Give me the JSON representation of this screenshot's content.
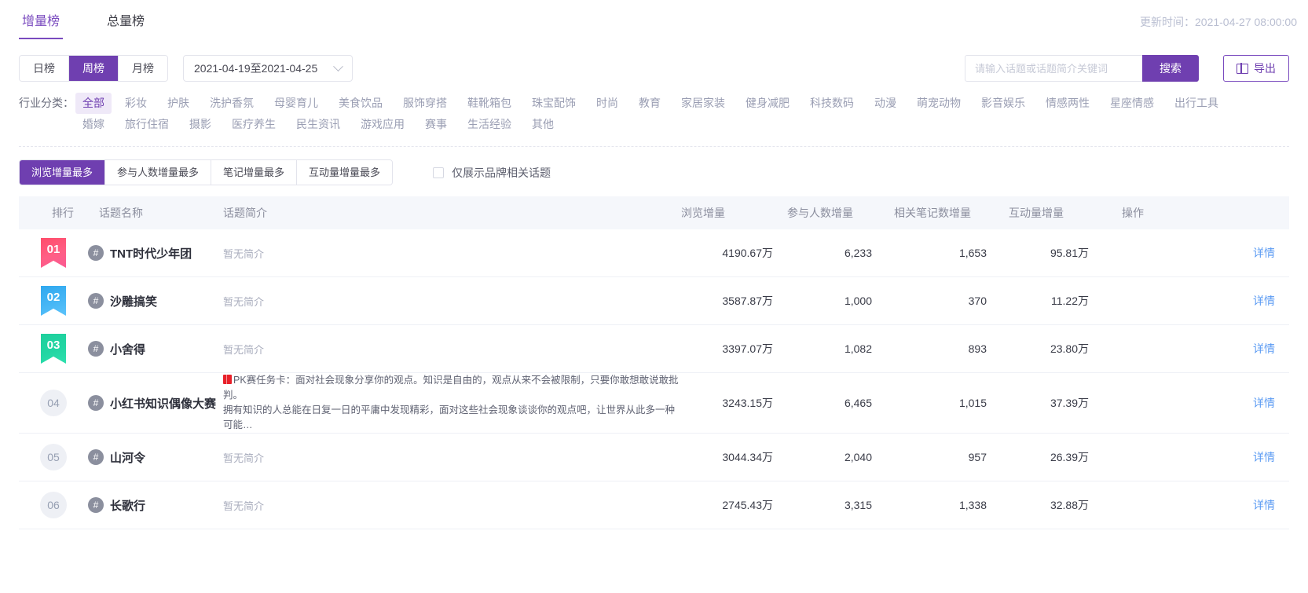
{
  "header": {
    "tabs": [
      {
        "label": "增量榜",
        "active": true
      },
      {
        "label": "总量榜",
        "active": false
      }
    ],
    "update_time": "更新时间：2021-04-27 08:00:00"
  },
  "filters": {
    "period": [
      {
        "label": "日榜",
        "active": false
      },
      {
        "label": "周榜",
        "active": true
      },
      {
        "label": "月榜",
        "active": false
      }
    ],
    "date_range": "2021-04-19至2021-04-25",
    "search_placeholder": "请输入话题或话题简介关键词",
    "search_value": "",
    "search_button": "搜索",
    "export_button": "导出"
  },
  "categories": {
    "label": "行业分类：",
    "items": [
      {
        "label": "全部",
        "active": true
      },
      {
        "label": "彩妆",
        "active": false
      },
      {
        "label": "护肤",
        "active": false
      },
      {
        "label": "洗护香氛",
        "active": false
      },
      {
        "label": "母婴育儿",
        "active": false
      },
      {
        "label": "美食饮品",
        "active": false
      },
      {
        "label": "服饰穿搭",
        "active": false
      },
      {
        "label": "鞋靴箱包",
        "active": false
      },
      {
        "label": "珠宝配饰",
        "active": false
      },
      {
        "label": "时尚",
        "active": false
      },
      {
        "label": "教育",
        "active": false
      },
      {
        "label": "家居家装",
        "active": false
      },
      {
        "label": "健身减肥",
        "active": false
      },
      {
        "label": "科技数码",
        "active": false
      },
      {
        "label": "动漫",
        "active": false
      },
      {
        "label": "萌宠动物",
        "active": false
      },
      {
        "label": "影音娱乐",
        "active": false
      },
      {
        "label": "情感两性",
        "active": false
      },
      {
        "label": "星座情感",
        "active": false
      },
      {
        "label": "出行工具",
        "active": false
      },
      {
        "label": "婚嫁",
        "active": false
      },
      {
        "label": "旅行住宿",
        "active": false
      },
      {
        "label": "摄影",
        "active": false
      },
      {
        "label": "医疗养生",
        "active": false
      },
      {
        "label": "民生资讯",
        "active": false
      },
      {
        "label": "游戏应用",
        "active": false
      },
      {
        "label": "赛事",
        "active": false
      },
      {
        "label": "生活经验",
        "active": false
      },
      {
        "label": "其他",
        "active": false
      }
    ]
  },
  "sort": {
    "options": [
      {
        "label": "浏览增量最多",
        "active": true
      },
      {
        "label": "参与人数增量最多",
        "active": false
      },
      {
        "label": "笔记增量最多",
        "active": false
      },
      {
        "label": "互动量增量最多",
        "active": false
      }
    ],
    "brand_only_label": "仅展示品牌相关话题",
    "brand_only_checked": false
  },
  "table": {
    "columns": [
      "排行",
      "话题名称",
      "话题简介",
      "浏览增量",
      "参与人数增量",
      "相关笔记数增量",
      "互动量增量",
      "操作"
    ],
    "action_label": "详情",
    "rows": [
      {
        "rank": "01",
        "rank_style": "ribbon-1",
        "name": "TNT时代少年团",
        "desc": "暂无简介",
        "desc_rich": false,
        "views": "4190.67万",
        "users": "6,233",
        "notes": "1,653",
        "interactions": "95.81万"
      },
      {
        "rank": "02",
        "rank_style": "ribbon-2",
        "name": "沙雕搞笑",
        "desc": "暂无简介",
        "desc_rich": false,
        "views": "3587.87万",
        "users": "1,000",
        "notes": "370",
        "interactions": "11.22万"
      },
      {
        "rank": "03",
        "rank_style": "ribbon-3",
        "name": "小舍得",
        "desc": "暂无简介",
        "desc_rich": false,
        "views": "3397.07万",
        "users": "1,082",
        "notes": "893",
        "interactions": "23.80万"
      },
      {
        "rank": "04",
        "rank_style": "circle",
        "name": "小红书知识偶像大赛",
        "desc_line1": "PK赛任务卡：面对社会现象分享你的观点。知识是自由的，观点从来不会被限制，只要你敢想敢说敢批判。",
        "desc_line2": "拥有知识的人总能在日复一日的平庸中发现精彩，面对这些社会现象谈谈你的观点吧，让世界从此多一种可能…",
        "desc_rich": true,
        "views": "3243.15万",
        "users": "6,465",
        "notes": "1,015",
        "interactions": "37.39万"
      },
      {
        "rank": "05",
        "rank_style": "circle",
        "name": "山河令",
        "desc": "暂无简介",
        "desc_rich": false,
        "views": "3044.34万",
        "users": "2,040",
        "notes": "957",
        "interactions": "26.39万"
      },
      {
        "rank": "06",
        "rank_style": "circle",
        "name": "长歌行",
        "desc": "暂无简介",
        "desc_rich": false,
        "views": "2745.43万",
        "users": "3,315",
        "notes": "1,338",
        "interactions": "32.88万"
      }
    ]
  }
}
